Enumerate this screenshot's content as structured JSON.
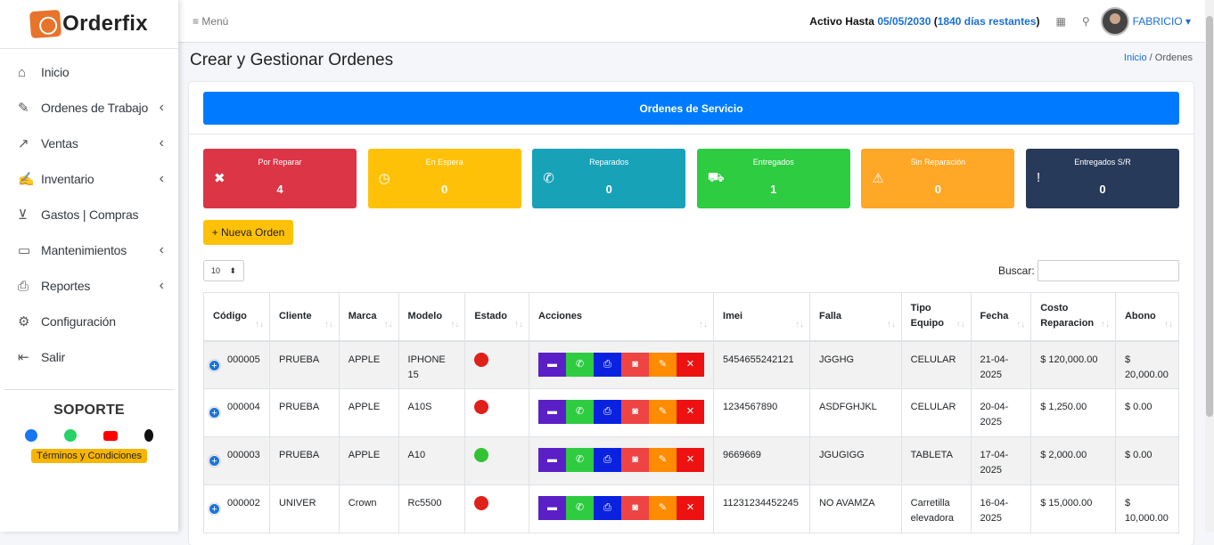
{
  "brand": {
    "name": "Orderfix"
  },
  "sidebar": {
    "items": [
      {
        "label": "Inicio",
        "icon": "home-icon",
        "glyph": "⌂",
        "arrow": false
      },
      {
        "label": "Ordenes de Trabajo",
        "icon": "wrench-icon",
        "glyph": "✎",
        "arrow": true
      },
      {
        "label": "Ventas",
        "icon": "chart-line-icon",
        "glyph": "↗",
        "arrow": true
      },
      {
        "label": "Inventario",
        "icon": "edit-icon",
        "glyph": "✍",
        "arrow": true
      },
      {
        "label": "Gastos | Compras",
        "icon": "cart-icon",
        "glyph": "⊻",
        "arrow": false
      },
      {
        "label": "Mantenimientos",
        "icon": "briefcase-icon",
        "glyph": "▭",
        "arrow": true
      },
      {
        "label": "Reportes",
        "icon": "printer-icon",
        "glyph": "⎙",
        "arrow": true
      },
      {
        "label": "Configuración",
        "icon": "gear-icon",
        "glyph": "⚙",
        "arrow": false
      },
      {
        "label": "Salir",
        "icon": "logout-icon",
        "glyph": "⇤",
        "arrow": false
      }
    ],
    "soporte": {
      "title": "SOPORTE",
      "terms": "Términos y Condiciones"
    }
  },
  "topbar": {
    "menu": "≡ Menú",
    "activo_label": "Activo Hasta",
    "activo_date": "05/05/2030",
    "activo_days": "1840 días restantes",
    "user": "FABRICIO"
  },
  "page": {
    "title": "Crear y Gestionar Ordenes",
    "crumb_home": "Inicio",
    "crumb_sep": "/",
    "crumb_current": "Ordenes"
  },
  "banner": "Ordenes de Servicio",
  "stats": [
    {
      "label": "Por Reparar",
      "value": "4",
      "color": "#dc3545",
      "glyph": "✖"
    },
    {
      "label": "En Espera",
      "value": "0",
      "color": "#ffc107",
      "glyph": "◷"
    },
    {
      "label": "Reparados",
      "value": "0",
      "color": "#17a2b8",
      "glyph": "✆"
    },
    {
      "label": "Entregados",
      "value": "1",
      "color": "#2ecc40",
      "glyph": "⛟"
    },
    {
      "label": "Sin Reparación",
      "value": "0",
      "color": "#ffa726",
      "glyph": "⚠"
    },
    {
      "label": "Entregados S/R",
      "value": "0",
      "color": "#283a5a",
      "glyph": "!"
    }
  ],
  "new_order": "+ Nueva Orden",
  "length_value": "10",
  "search_label": "Buscar:",
  "table": {
    "headers": [
      "Código",
      "Cliente",
      "Marca",
      "Modelo",
      "Estado",
      "Acciones",
      "Imei",
      "Falla",
      "Tipo Equipo",
      "Fecha",
      "Costo Reparacion",
      "Abono"
    ],
    "rows": [
      {
        "code": "000005",
        "cliente": "PRUEBA",
        "marca": "APPLE",
        "modelo": "IPHONE 15",
        "estado": "#e0201b",
        "imei": "5454655242121",
        "falla": "JGGHG",
        "tipo": "CELULAR",
        "fecha": "21-04-2025",
        "costo": "$ 120,000.00",
        "abono": "$ 20,000.00"
      },
      {
        "code": "000004",
        "cliente": "PRUEBA",
        "marca": "APPLE",
        "modelo": "A10S",
        "estado": "#e0201b",
        "imei": "1234567890",
        "falla": "ASDFGHJKL",
        "tipo": "CELULAR",
        "fecha": "20-04-2025",
        "costo": "$ 1,250.00",
        "abono": "$ 0.00"
      },
      {
        "code": "000003",
        "cliente": "PRUEBA",
        "marca": "APPLE",
        "modelo": "A10",
        "estado": "#33c233",
        "imei": "9669669",
        "falla": "JGUGIGG",
        "tipo": "TABLETA",
        "fecha": "17-04-2025",
        "costo": "$ 2,000.00",
        "abono": "$ 0.00"
      },
      {
        "code": "000002",
        "cliente": "UNIVER",
        "marca": "Crown",
        "modelo": "Rc5500",
        "estado": "#e0201b",
        "imei": "11231234452245",
        "falla": "NO AVAMZA",
        "tipo": "Carretilla elevadora",
        "fecha": "16-04-2025",
        "costo": "$ 15,000.00",
        "abono": "$ 10,000.00"
      }
    ]
  },
  "actions": [
    {
      "name": "ticket-button",
      "color": "#5b1fc7",
      "glyph": "▬"
    },
    {
      "name": "whatsapp-button",
      "color": "#2ecc40",
      "glyph": "✆"
    },
    {
      "name": "print-button",
      "color": "#0a22e0",
      "glyph": "⎙"
    },
    {
      "name": "camera-button",
      "color": "#ee4444",
      "glyph": "◙"
    },
    {
      "name": "edit-button",
      "color": "#ff8c00",
      "glyph": "✎"
    },
    {
      "name": "delete-button",
      "color": "#ee1111",
      "glyph": "✕"
    }
  ],
  "social_colors": {
    "facebook": "#1877f2",
    "whatsapp": "#25d366",
    "youtube": "#ff0000",
    "tiktok": "#111111"
  }
}
